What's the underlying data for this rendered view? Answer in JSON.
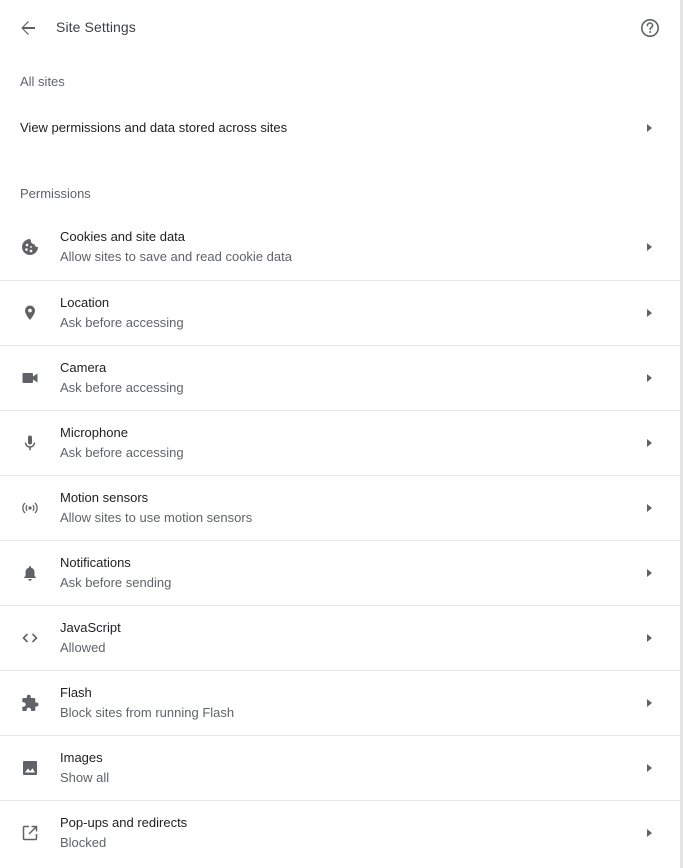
{
  "header": {
    "title": "Site Settings"
  },
  "all_sites": {
    "heading": "All sites",
    "row_label": "View permissions and data stored across sites"
  },
  "permissions": {
    "heading": "Permissions",
    "items": [
      {
        "title": "Cookies and site data",
        "subtitle": "Allow sites to save and read cookie data",
        "icon": "cookie-icon"
      },
      {
        "title": "Location",
        "subtitle": "Ask before accessing",
        "icon": "location-pin-icon"
      },
      {
        "title": "Camera",
        "subtitle": "Ask before accessing",
        "icon": "camera-icon"
      },
      {
        "title": "Microphone",
        "subtitle": "Ask before accessing",
        "icon": "microphone-icon"
      },
      {
        "title": "Motion sensors",
        "subtitle": "Allow sites to use motion sensors",
        "icon": "sensors-icon"
      },
      {
        "title": "Notifications",
        "subtitle": "Ask before sending",
        "icon": "bell-icon"
      },
      {
        "title": "JavaScript",
        "subtitle": "Allowed",
        "icon": "code-icon"
      },
      {
        "title": "Flash",
        "subtitle": "Block sites from running Flash",
        "icon": "puzzle-icon"
      },
      {
        "title": "Images",
        "subtitle": "Show all",
        "icon": "image-icon"
      },
      {
        "title": "Pop-ups and redirects",
        "subtitle": "Blocked",
        "icon": "open-in-new-icon"
      }
    ]
  },
  "colors": {
    "icon": "#5f6368",
    "text_primary": "#202124",
    "text_secondary": "#5f6368",
    "divider": "#e8e8e8"
  }
}
